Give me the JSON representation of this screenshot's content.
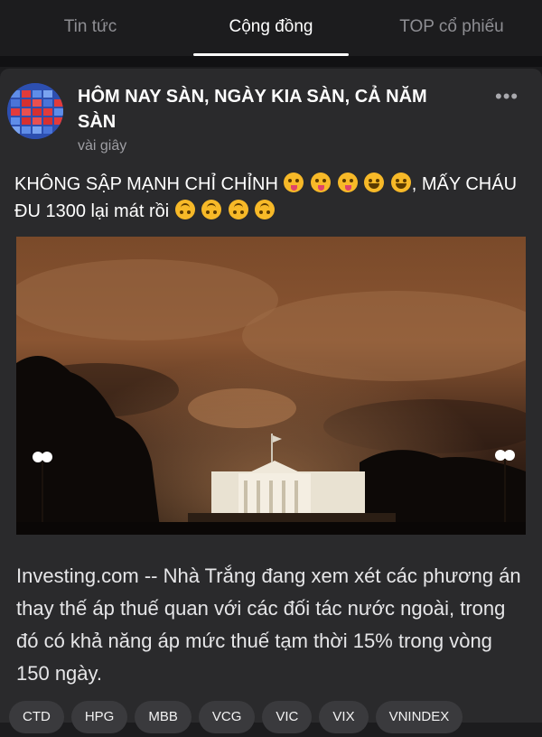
{
  "tabs": [
    {
      "label": "Tin tức",
      "active": false
    },
    {
      "label": "Cộng đồng",
      "active": true
    },
    {
      "label": "TOP cổ phiếu",
      "active": false
    }
  ],
  "post": {
    "title": "HÔM NAY SÀN, NGÀY KIA SÀN, CẢ NĂM SÀN",
    "time": "vài giây",
    "more_icon": "ellipsis-icon",
    "content_part1": "KHÔNG SẬP MẠNH CHỈ CHỈNH",
    "content_part2": ", MẤY CHÁU ĐU 1300 lại mát rồi",
    "emojis_part1": [
      "zany-face-icon",
      "zany-face-icon",
      "zany-face-icon",
      "rofl-face-icon",
      "rofl-face-icon"
    ],
    "emojis_part2": [
      "upside-down-face-icon",
      "upside-down-face-icon",
      "upside-down-face-icon",
      "upside-down-face-icon"
    ],
    "article_text": "Investing.com -- Nhà Trắng đang xem xét các phương án thay thế áp thuế quan với các đối tác nước ngoài, trong đó có khả năng áp mức thuế tạm thời 15% trong vòng 150 ngày."
  },
  "tickers": [
    "CTD",
    "HPG",
    "MBB",
    "VCG",
    "VIC",
    "VIX",
    "VNINDEX"
  ],
  "colors": {
    "background": "#1c1c1e",
    "card": "#2a2a2c",
    "chip": "#3a3a3d",
    "muted_text": "#8e8e93"
  }
}
